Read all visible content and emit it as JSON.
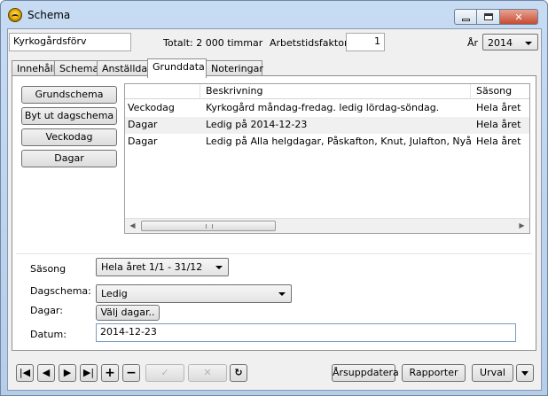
{
  "window": {
    "title": "Schema"
  },
  "header": {
    "unit_name": "Kyrkogårdsförv",
    "total_label": "Totalt: 2 000 timmar",
    "factor_label": "Arbetstidsfaktor:",
    "factor_value": "1",
    "year_label": "År",
    "year_value": "2014"
  },
  "tabs": [
    {
      "label": "Innehåll",
      "active": false
    },
    {
      "label": "Schema",
      "active": false
    },
    {
      "label": "Anställda",
      "active": false
    },
    {
      "label": "Grunddata",
      "active": true
    },
    {
      "label": "Noteringar",
      "active": false
    }
  ],
  "sidebar": {
    "buttons": [
      "Grundschema",
      "Byt ut dagschema",
      "Veckodag",
      "Dagar"
    ]
  },
  "grid": {
    "columns": [
      "",
      "Beskrivning",
      "Säsong"
    ],
    "rows": [
      [
        "Veckodag",
        "Kyrkogård måndag-fredag. ledig lördag-söndag.",
        "Hela året"
      ],
      [
        "Dagar",
        "Ledig på 2014-12-23",
        "Hela året"
      ],
      [
        "Dagar",
        "Ledig på Alla helgdagar, Påskafton, Knut, Julafton, Nyårsafton",
        "Hela året"
      ]
    ]
  },
  "form": {
    "season_label": "Säsong",
    "season_value": "Hela året 1/1 - 31/12",
    "dayschema_label": "Dagschema:",
    "dayschema_value": "Ledig",
    "days_label": "Dagar:",
    "choose_days_button": "Välj dagar..",
    "date_label": "Datum:",
    "date_value": "2014-12-23"
  },
  "toolbar": {
    "update_year_button": "Årsuppdatera",
    "reports_button": "Rapporter",
    "selection_button": "Urval"
  },
  "icons": {
    "first": "first-record-icon",
    "prev": "previous-record-icon",
    "next": "next-record-icon",
    "last": "last-record-icon",
    "add": "add-icon",
    "remove": "remove-icon",
    "confirm": "checkmark-icon",
    "cancel": "cross-icon",
    "refresh": "refresh-icon"
  }
}
